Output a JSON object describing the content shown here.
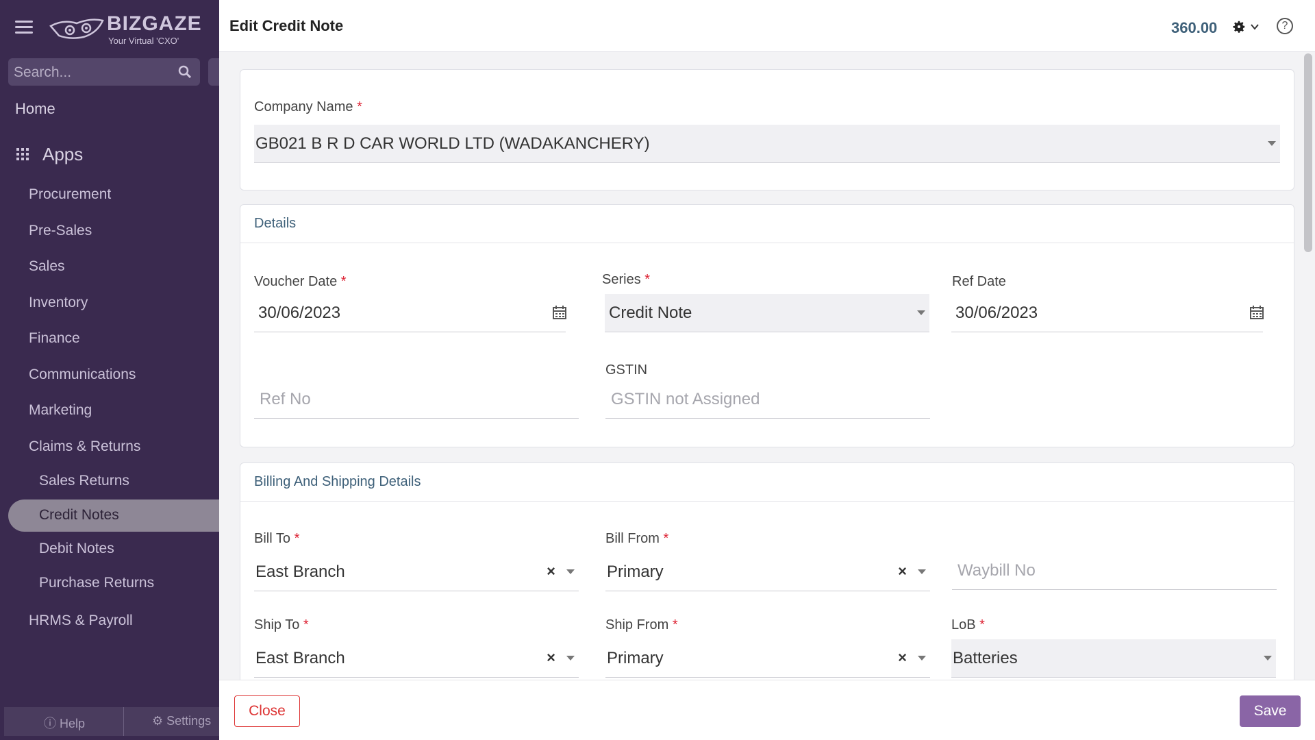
{
  "sidebar": {
    "logo_text": "BIZGAZE",
    "logo_tagline": "Your Virtual 'CXO'",
    "search_placeholder": "Search...",
    "home": "Home",
    "apps": "Apps",
    "items": [
      "Procurement",
      "Pre-Sales",
      "Sales",
      "Inventory",
      "Finance",
      "Communications",
      "Marketing",
      "Claims & Returns"
    ],
    "sub_items": [
      "Sales Returns",
      "Credit Notes",
      "Debit Notes",
      "Purchase Returns"
    ],
    "active_sub_item": "Credit Notes",
    "hrms": "HRMS & Payroll",
    "footer_help": "Help",
    "footer_settings": "Settings"
  },
  "header": {
    "title": "Edit Credit Note",
    "amount": "360.00"
  },
  "company": {
    "label": "Company Name",
    "value": "GB021 B R D CAR WORLD LTD (WADAKANCHERY)"
  },
  "details": {
    "heading": "Details",
    "voucher_date_label": "Voucher Date",
    "voucher_date": "30/06/2023",
    "series_label": "Series",
    "series": "Credit Note",
    "ref_date_label": "Ref Date",
    "ref_date": "30/06/2023",
    "ref_no_placeholder": "Ref No",
    "gstin_label": "GSTIN",
    "gstin_placeholder": "GSTIN not Assigned"
  },
  "billing": {
    "heading": "Billing And Shipping Details",
    "bill_to_label": "Bill To",
    "bill_to": "East Branch",
    "bill_from_label": "Bill From",
    "bill_from": "Primary",
    "waybill_placeholder": "Waybill No",
    "ship_to_label": "Ship To",
    "ship_to": "East Branch",
    "ship_from_label": "Ship From",
    "ship_from": "Primary",
    "lob_label": "LoB",
    "lob": "Batteries"
  },
  "footer": {
    "close_label": "Close",
    "save_label": "Save"
  },
  "colors": {
    "sidebar_bg": "#3a2a4f",
    "accent": "#8a65a6",
    "heading_teal": "#3e6079",
    "required": "#dd2233"
  }
}
